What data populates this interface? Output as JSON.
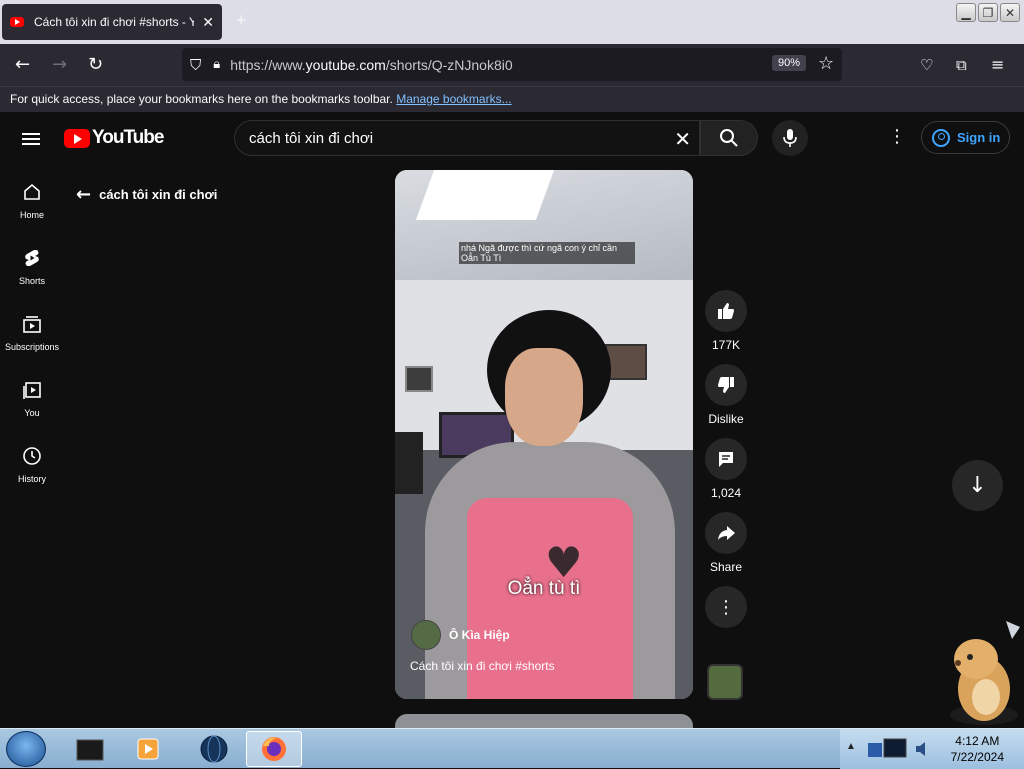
{
  "browser": {
    "tab_title": "Cách tôi xin đi chơi #shorts - YouTube",
    "new_tab": "+",
    "url_domain_prefix": "https://www.",
    "url_domain": "youtube.com",
    "url_path": "/shorts/Q-zNJnok8i0",
    "zoom": "90%",
    "bookmarks_text": "For quick access, place your bookmarks here on the bookmarks toolbar.",
    "bookmarks_link": "Manage bookmarks..."
  },
  "youtube": {
    "logo_text": "YouTube",
    "search_query": "cách tôi xin đi chơi",
    "sign_in": "Sign in",
    "back_title": "cách tôi xin đi chơi",
    "sidebar": [
      {
        "label": "Home",
        "icon": "home-icon"
      },
      {
        "label": "Shorts",
        "icon": "shorts-icon"
      },
      {
        "label": "Subscriptions",
        "icon": "subscriptions-icon"
      },
      {
        "label": "You",
        "icon": "you-icon"
      },
      {
        "label": "History",
        "icon": "history-icon"
      }
    ]
  },
  "short": {
    "caption_top": "nhá Ngã được thì cứ ngã con ý chỉ cần Oẳn Tù Tì",
    "caption_bottom": "Oẳn tù tì",
    "channel": "Ô Kìa Hiệp",
    "title": "Cách tôi xin đi chơi #shorts",
    "likes": "177K",
    "dislike": "Dislike",
    "comments": "1,024",
    "share": "Share"
  },
  "taskbar": {
    "time": "4:12 AM",
    "date": "7/22/2024"
  }
}
